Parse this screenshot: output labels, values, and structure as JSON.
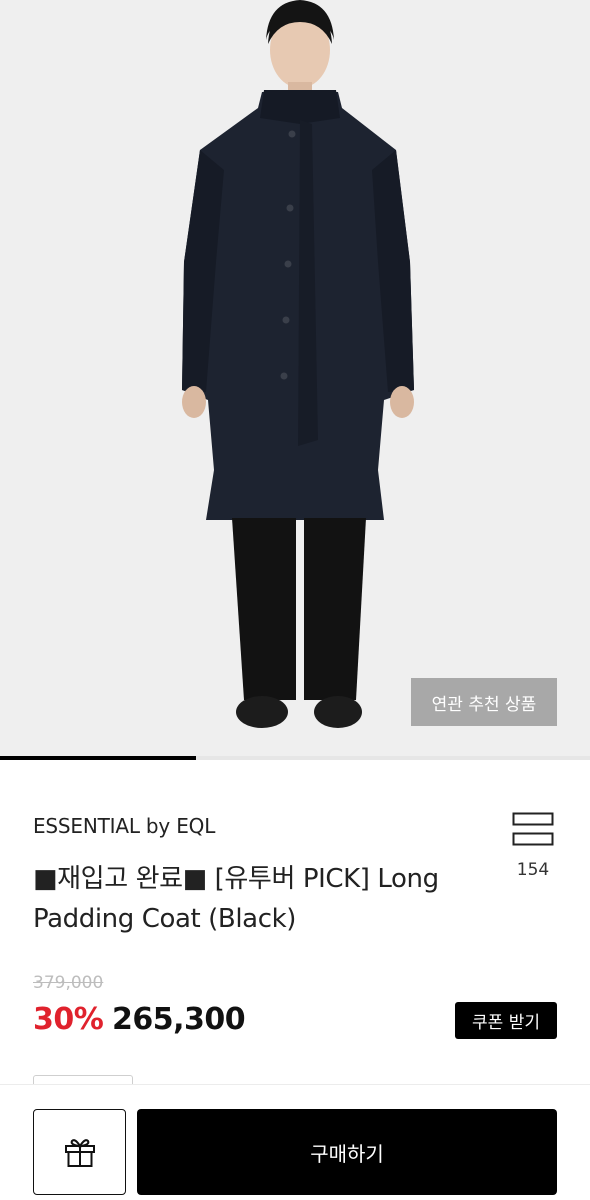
{
  "hero": {
    "related_label": "연관 추천 상품",
    "image_index_progress": 0.333
  },
  "product": {
    "brand": "ESSENTIAL by EQL",
    "title": "■재입고 완료■ [유투버 PICK] Long Padding Coat (Black)",
    "bookmark_count": "154",
    "original_price": "379,000",
    "discount": "30%",
    "sale_price": "265,300",
    "coupon_label": "쿠폰 받기"
  },
  "bottom_bar": {
    "gift_icon": "gift-icon",
    "buy_label": "구매하기"
  },
  "colors": {
    "accent_red": "#e0222d",
    "black": "#000000",
    "hero_bg": "#efefef"
  }
}
